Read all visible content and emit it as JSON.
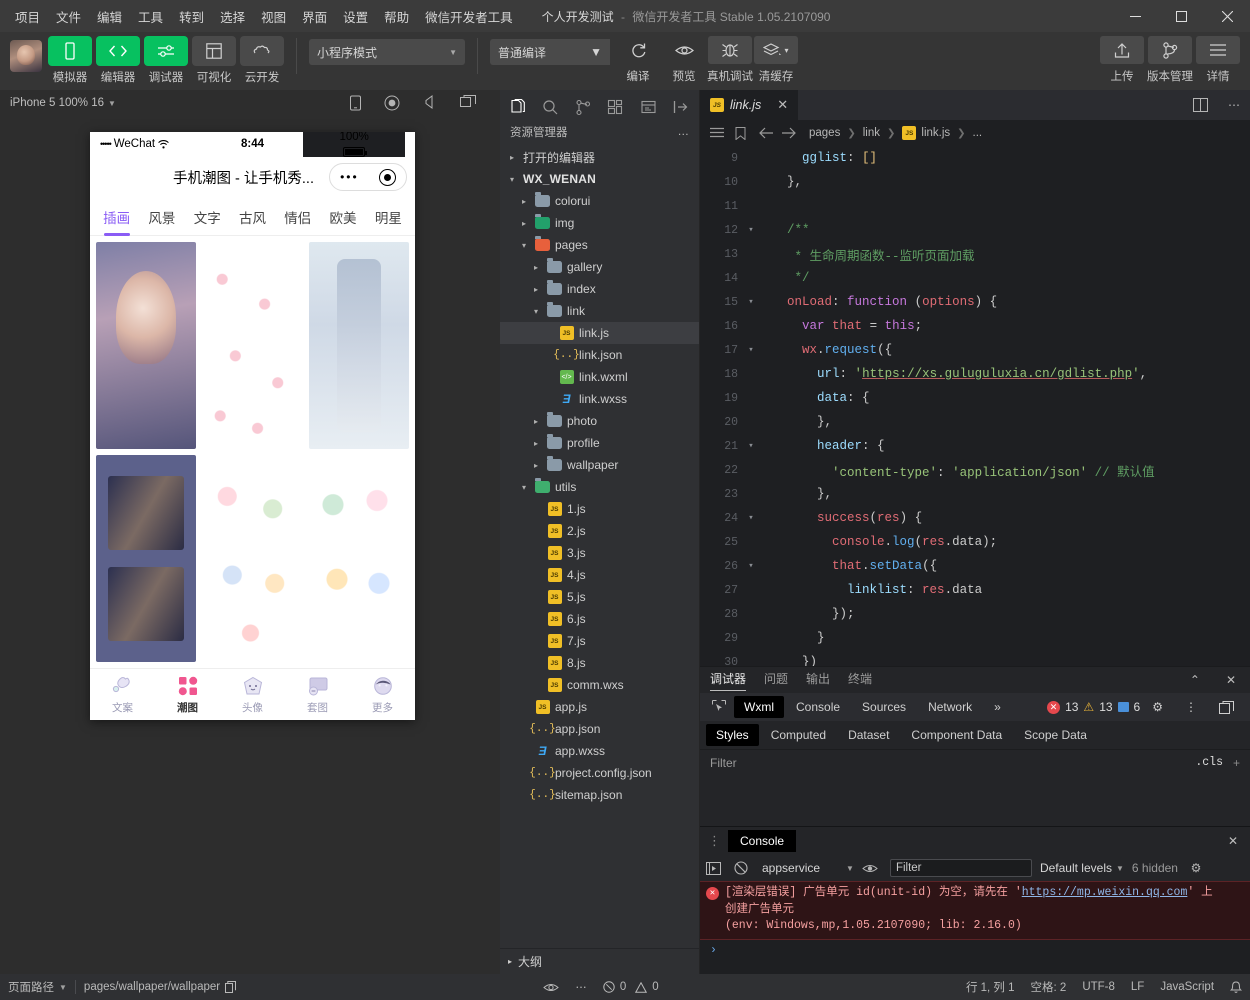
{
  "titlebar": {
    "menus": [
      "项目",
      "文件",
      "编辑",
      "工具",
      "转到",
      "选择",
      "视图",
      "界面",
      "设置",
      "帮助",
      "微信开发者工具"
    ],
    "project": "个人开发测试",
    "separator": "-",
    "app_version": "微信开发者工具 Stable 1.05.2107090",
    "minimize": "—",
    "maximize": "▢",
    "close": "✕"
  },
  "toolbar": {
    "buttons": [
      {
        "label": "模拟器",
        "icon": "phone-icon",
        "style": "green"
      },
      {
        "label": "编辑器",
        "icon": "code-icon",
        "style": "green"
      },
      {
        "label": "调试器",
        "icon": "sliders-icon",
        "style": "green"
      },
      {
        "label": "可视化",
        "icon": "layout-icon",
        "style": "grey"
      },
      {
        "label": "云开发",
        "icon": "cloud-icon",
        "style": "grey"
      }
    ],
    "mode_select": "小程序模式",
    "compile_select": "普通编译",
    "actions": [
      {
        "label": "编译",
        "icon": "refresh-icon"
      },
      {
        "label": "预览",
        "icon": "eye-icon"
      },
      {
        "label": "真机调试",
        "icon": "bug-icon"
      },
      {
        "label": "清缓存",
        "icon": "layers-icon"
      }
    ],
    "right_actions": [
      {
        "label": "上传",
        "icon": "upload-icon"
      },
      {
        "label": "版本管理",
        "icon": "branch-icon"
      },
      {
        "label": "详情",
        "icon": "menu-icon"
      }
    ]
  },
  "simulator": {
    "device": "iPhone 5 100% 16",
    "icons": [
      "phone-rotate-icon",
      "record-icon",
      "volume-icon",
      "window-icon"
    ],
    "phone": {
      "carrier": "WeChat",
      "signal_dots": "•••••",
      "time": "8:44",
      "battery": "100%",
      "page_title": "手机潮图 - 让手机秀...",
      "tabs": [
        "插画",
        "风景",
        "文字",
        "古风",
        "情侣",
        "欧美",
        "明星"
      ],
      "active_tab": "插画",
      "tabbar": [
        {
          "label": "文案",
          "icon": "balloon-icon"
        },
        {
          "label": "潮图",
          "icon": "grid-icon"
        },
        {
          "label": "头像",
          "icon": "avatar-icon"
        },
        {
          "label": "套图",
          "icon": "album-icon"
        },
        {
          "label": "更多",
          "icon": "more-icon"
        }
      ],
      "tabbar_active": "潮图"
    }
  },
  "explorer": {
    "activity_icons": [
      "files-icon",
      "search-icon",
      "source-control-icon",
      "extensions-icon",
      "debug-icon",
      "collapse-icon"
    ],
    "title": "资源管理器",
    "more": "…",
    "sections": [
      {
        "label": "打开的编辑器",
        "arrow": "▸",
        "type": "section"
      },
      {
        "label": "WX_WENAN",
        "arrow": "▾",
        "type": "root"
      }
    ],
    "tree": [
      {
        "label": "colorui",
        "type": "folder",
        "indent": 2,
        "arrow": "▸",
        "color": "grey"
      },
      {
        "label": "img",
        "type": "folder",
        "indent": 2,
        "arrow": "▸",
        "color": "green"
      },
      {
        "label": "pages",
        "type": "folder",
        "indent": 2,
        "arrow": "▾",
        "color": "orange"
      },
      {
        "label": "gallery",
        "type": "folder",
        "indent": 3,
        "arrow": "▸",
        "color": "grey"
      },
      {
        "label": "index",
        "type": "folder",
        "indent": 3,
        "arrow": "▸",
        "color": "grey"
      },
      {
        "label": "link",
        "type": "folder",
        "indent": 3,
        "arrow": "▾",
        "color": "grey"
      },
      {
        "label": "link.js",
        "type": "js",
        "indent": 4,
        "selected": true
      },
      {
        "label": "link.json",
        "type": "json",
        "indent": 4
      },
      {
        "label": "link.wxml",
        "type": "wxml",
        "indent": 4
      },
      {
        "label": "link.wxss",
        "type": "wxss",
        "indent": 4
      },
      {
        "label": "photo",
        "type": "folder",
        "indent": 3,
        "arrow": "▸",
        "color": "grey"
      },
      {
        "label": "profile",
        "type": "folder",
        "indent": 3,
        "arrow": "▸",
        "color": "grey"
      },
      {
        "label": "wallpaper",
        "type": "folder",
        "indent": 3,
        "arrow": "▸",
        "color": "grey"
      },
      {
        "label": "utils",
        "type": "folder",
        "indent": 2,
        "arrow": "▾",
        "color": "gdot"
      },
      {
        "label": "1.js",
        "type": "js",
        "indent": 3
      },
      {
        "label": "2.js",
        "type": "js",
        "indent": 3
      },
      {
        "label": "3.js",
        "type": "js",
        "indent": 3
      },
      {
        "label": "4.js",
        "type": "js",
        "indent": 3
      },
      {
        "label": "5.js",
        "type": "js",
        "indent": 3
      },
      {
        "label": "6.js",
        "type": "js",
        "indent": 3
      },
      {
        "label": "7.js",
        "type": "js",
        "indent": 3
      },
      {
        "label": "8.js",
        "type": "js",
        "indent": 3
      },
      {
        "label": "comm.wxs",
        "type": "js",
        "indent": 3
      },
      {
        "label": "app.js",
        "type": "js",
        "indent": 2
      },
      {
        "label": "app.json",
        "type": "json",
        "indent": 2
      },
      {
        "label": "app.wxss",
        "type": "wxss",
        "indent": 2
      },
      {
        "label": "project.config.json",
        "type": "json",
        "indent": 2
      },
      {
        "label": "sitemap.json",
        "type": "json",
        "indent": 2
      }
    ],
    "outline": {
      "label": "大纲",
      "arrow": "▸"
    }
  },
  "editor": {
    "tab": {
      "name": "link.js",
      "close": "✕",
      "icon": "js-icon"
    },
    "split_icon": "split-editor-icon",
    "more_icon": "more-icon",
    "breadcrumb": [
      "pages",
      "link",
      "link.js",
      "..."
    ],
    "breadcrumb_icons": [
      "list-icon",
      "bookmark-icon",
      "back-arrow-icon",
      "forward-arrow-icon"
    ],
    "lines": [
      {
        "num": "9",
        "fold": "",
        "text": "    gglist: []"
      },
      {
        "num": "10",
        "fold": "",
        "text": "  },"
      },
      {
        "num": "11",
        "fold": "",
        "text": ""
      },
      {
        "num": "12",
        "fold": "▾",
        "text": "  /**"
      },
      {
        "num": "13",
        "fold": "",
        "text": "   * 生命周期函数--监听页面加载"
      },
      {
        "num": "14",
        "fold": "",
        "text": "   */"
      },
      {
        "num": "15",
        "fold": "▾",
        "text": "  onLoad: function (options) {"
      },
      {
        "num": "16",
        "fold": "",
        "text": "    var that = this;"
      },
      {
        "num": "17",
        "fold": "▾",
        "text": "    wx.request({"
      },
      {
        "num": "18",
        "fold": "",
        "text": "      url: 'https://xs.guluguluxia.cn/gdlist.php',"
      },
      {
        "num": "19",
        "fold": "",
        "text": "      data: {"
      },
      {
        "num": "20",
        "fold": "",
        "text": "      },"
      },
      {
        "num": "21",
        "fold": "▾",
        "text": "      header: {"
      },
      {
        "num": "22",
        "fold": "",
        "text": "        'content-type': 'application/json' // 默认值"
      },
      {
        "num": "23",
        "fold": "",
        "text": "      },"
      },
      {
        "num": "24",
        "fold": "▾",
        "text": "      success(res) {"
      },
      {
        "num": "25",
        "fold": "",
        "text": "        console.log(res.data);"
      },
      {
        "num": "26",
        "fold": "▾",
        "text": "        that.setData({"
      },
      {
        "num": "27",
        "fold": "",
        "text": "          linklist: res.data"
      },
      {
        "num": "28",
        "fold": "",
        "text": "        });"
      },
      {
        "num": "29",
        "fold": "",
        "text": "      }"
      },
      {
        "num": "30",
        "fold": "",
        "text": "    })"
      }
    ]
  },
  "debugger": {
    "top_tabs": [
      "调试器",
      "问题",
      "输出",
      "终端"
    ],
    "top_active": "调试器",
    "collapse_icon": "chevron-up-icon",
    "close_icon": "close-icon",
    "devtools_tabs": [
      "Wxml",
      "Console",
      "Sources",
      "Network"
    ],
    "devtools_active": "Wxml",
    "overflow": "»",
    "picker_icon": "element-picker-icon",
    "counts": {
      "errors": "13",
      "warnings": "13",
      "info": "6"
    },
    "gear_icon": "gear-icon",
    "kebab_icon": "kebab-icon",
    "dock_icon": "dock-icon",
    "sub_tabs": [
      "Styles",
      "Computed",
      "Dataset",
      "Component Data",
      "Scope Data"
    ],
    "sub_active": "Styles",
    "filter_placeholder": "Filter",
    "cls_label": ".cls",
    "plus": "+"
  },
  "console": {
    "title": "Console",
    "grip_icon": "drag-grip-icon",
    "close_icon": "close-icon",
    "execute_icon": "execute-context-icon",
    "clear_icon": "clear-console-icon",
    "context": "appservice",
    "eye_icon": "eye-icon",
    "filter_placeholder": "Filter",
    "levels": "Default levels",
    "hidden": "6 hidden",
    "settings_icon": "gear-icon",
    "error": {
      "line1": "[渲染层错误] 广告单元 id(unit-id) 为空，请先在 '",
      "link": "https://mp.weixin.qq.com",
      "line1b": "' 上",
      "line2": "创建广告单元",
      "line3": "(env: Windows,mp,1.05.2107090; lib: 2.16.0)"
    },
    "prompt": "›"
  },
  "status": {
    "left_label": "页面路径",
    "left_caret": "▾",
    "path": "pages/wallpaper/wallpaper",
    "copy_icon": "copy-icon",
    "eye_icon": "eye-icon",
    "more_icon": "more-icon",
    "problems": {
      "errors": "0",
      "warnings": "0"
    },
    "cursor": "行 1, 列 1",
    "spaces": "空格: 2",
    "encoding": "UTF-8",
    "eol": "LF",
    "language": "JavaScript",
    "bell_icon": "bell-icon"
  },
  "colors": {
    "accent": "#07c160",
    "error": "#e5484d",
    "warning": "#e8b339",
    "purple": "#8a5cf5"
  }
}
